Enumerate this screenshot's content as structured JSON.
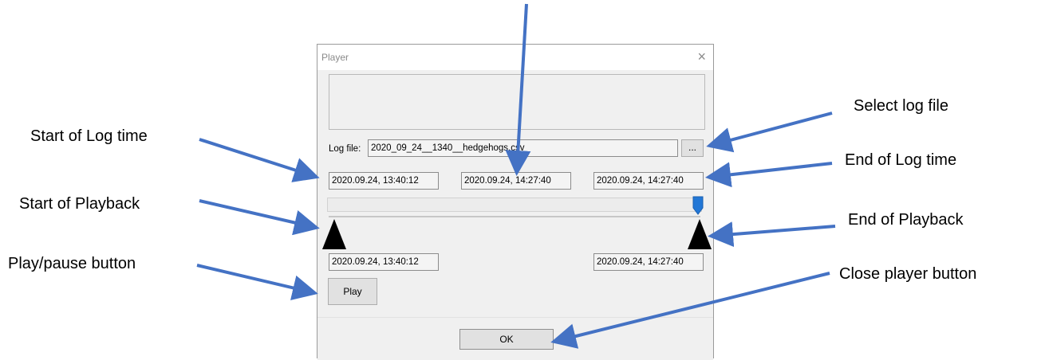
{
  "dialog": {
    "title": "Player",
    "close_glyph": "×",
    "log_file_label": "Log file:",
    "log_file_value": "2020_09_24__1340__hedgehogs.csv",
    "browse_label": "...",
    "log_start_time": "2020.09.24, 13:40:12",
    "current_time": "2020.09.24, 14:27:40",
    "log_end_time": "2020.09.24, 14:27:40",
    "playback_start_time": "2020.09.24, 13:40:12",
    "playback_end_time": "2020.09.24, 14:27:40",
    "play_label": "Play",
    "ok_label": "OK",
    "position_fraction": 1.0
  },
  "annotations": {
    "start_log_time": "Start of Log time",
    "start_playback": "Start of Playback",
    "play_pause": "Play/pause button",
    "select_log_file": "Select log file",
    "end_log_time": "End of Log time",
    "end_playback": "End of Playback",
    "close_player": "Close player button"
  },
  "colors": {
    "arrow": "#4472c4",
    "slider_thumb": "#2277d6",
    "marker": "#000000"
  }
}
